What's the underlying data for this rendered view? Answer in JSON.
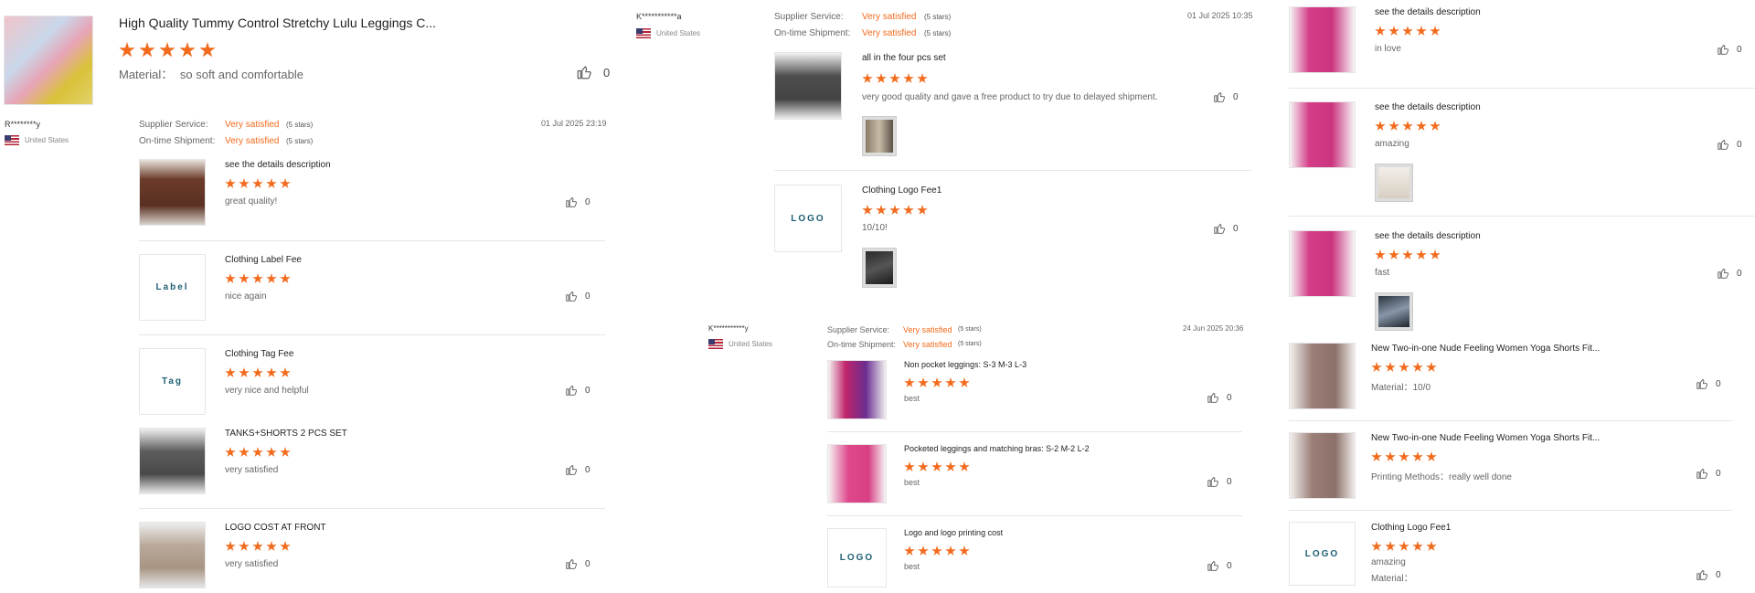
{
  "product": {
    "title": "High Quality Tummy Control Stretchy Lulu Leggings C...",
    "material_label": "Material：",
    "material_value": "so soft and comfortable",
    "likes": "0"
  },
  "colors": {
    "accent": "#f26b1d",
    "logo_text": "#1e5f73"
  },
  "ratings": {
    "supplier_label": "Supplier Service:",
    "shipment_label": "On-time Shipment:",
    "value": "Very satisfied",
    "stars_text": "(5 stars)"
  },
  "reviews": [
    {
      "user": "R********y",
      "country": "United States",
      "date": "01 Jul 2025 23:19",
      "items": [
        {
          "title": "see the details description",
          "text": "great quality!",
          "likes": "0"
        },
        {
          "title": "Clothing Label Fee",
          "text": "nice again",
          "likes": "0",
          "logo": "Label"
        },
        {
          "title": "Clothing Tag Fee",
          "text": "very nice and helpful",
          "likes": "0",
          "logo": "Tag"
        },
        {
          "title": "TANKS+SHORTS 2 PCS SET",
          "text": "very satisfied",
          "likes": "0"
        },
        {
          "title": "LOGO COST AT FRONT",
          "text": "very satisfied",
          "likes": "0"
        }
      ]
    },
    {
      "user": "K***********a",
      "country": "United States",
      "date": "01 Jul 2025 10:35",
      "items": [
        {
          "title": "all in the four pcs set",
          "text": "very good quality and gave a free product to try due to delayed shipment.",
          "likes": "0"
        },
        {
          "title": "Clothing Logo Fee1",
          "text": "10/10!",
          "likes": "0",
          "logo": "LOGO"
        }
      ]
    },
    {
      "user": "K***********y",
      "country": "United States",
      "date": "24 Jun 2025 20:36",
      "items": [
        {
          "title": "Non pocket leggings: S-3 M-3 L-3",
          "text": "best",
          "likes": "0"
        },
        {
          "title": "Pocketed leggings and matching bras: S-2 M-2 L-2",
          "text": "best",
          "likes": "0"
        },
        {
          "title": "Logo and logo printing cost",
          "text": "best",
          "likes": "0",
          "logo": "LOGO"
        }
      ]
    }
  ],
  "right_column": [
    {
      "title": "see the details description",
      "text": "in love",
      "likes": "0"
    },
    {
      "title": "see the details description",
      "text": "amazing",
      "likes": "0"
    },
    {
      "title": "see the details description",
      "text": "fast",
      "likes": "0"
    },
    {
      "title": "New Two-in-one Nude Feeling Women Yoga Shorts Fit...",
      "text": "Material：10/0",
      "likes": "0"
    },
    {
      "title": "New Two-in-one Nude Feeling Women Yoga Shorts Fit...",
      "text": "Printing Methods：really well done",
      "likes": "0"
    },
    {
      "title": "Clothing Logo Fee1",
      "text": "amazing",
      "text2": "Material：",
      "likes": "0",
      "logo": "LOGO"
    }
  ]
}
